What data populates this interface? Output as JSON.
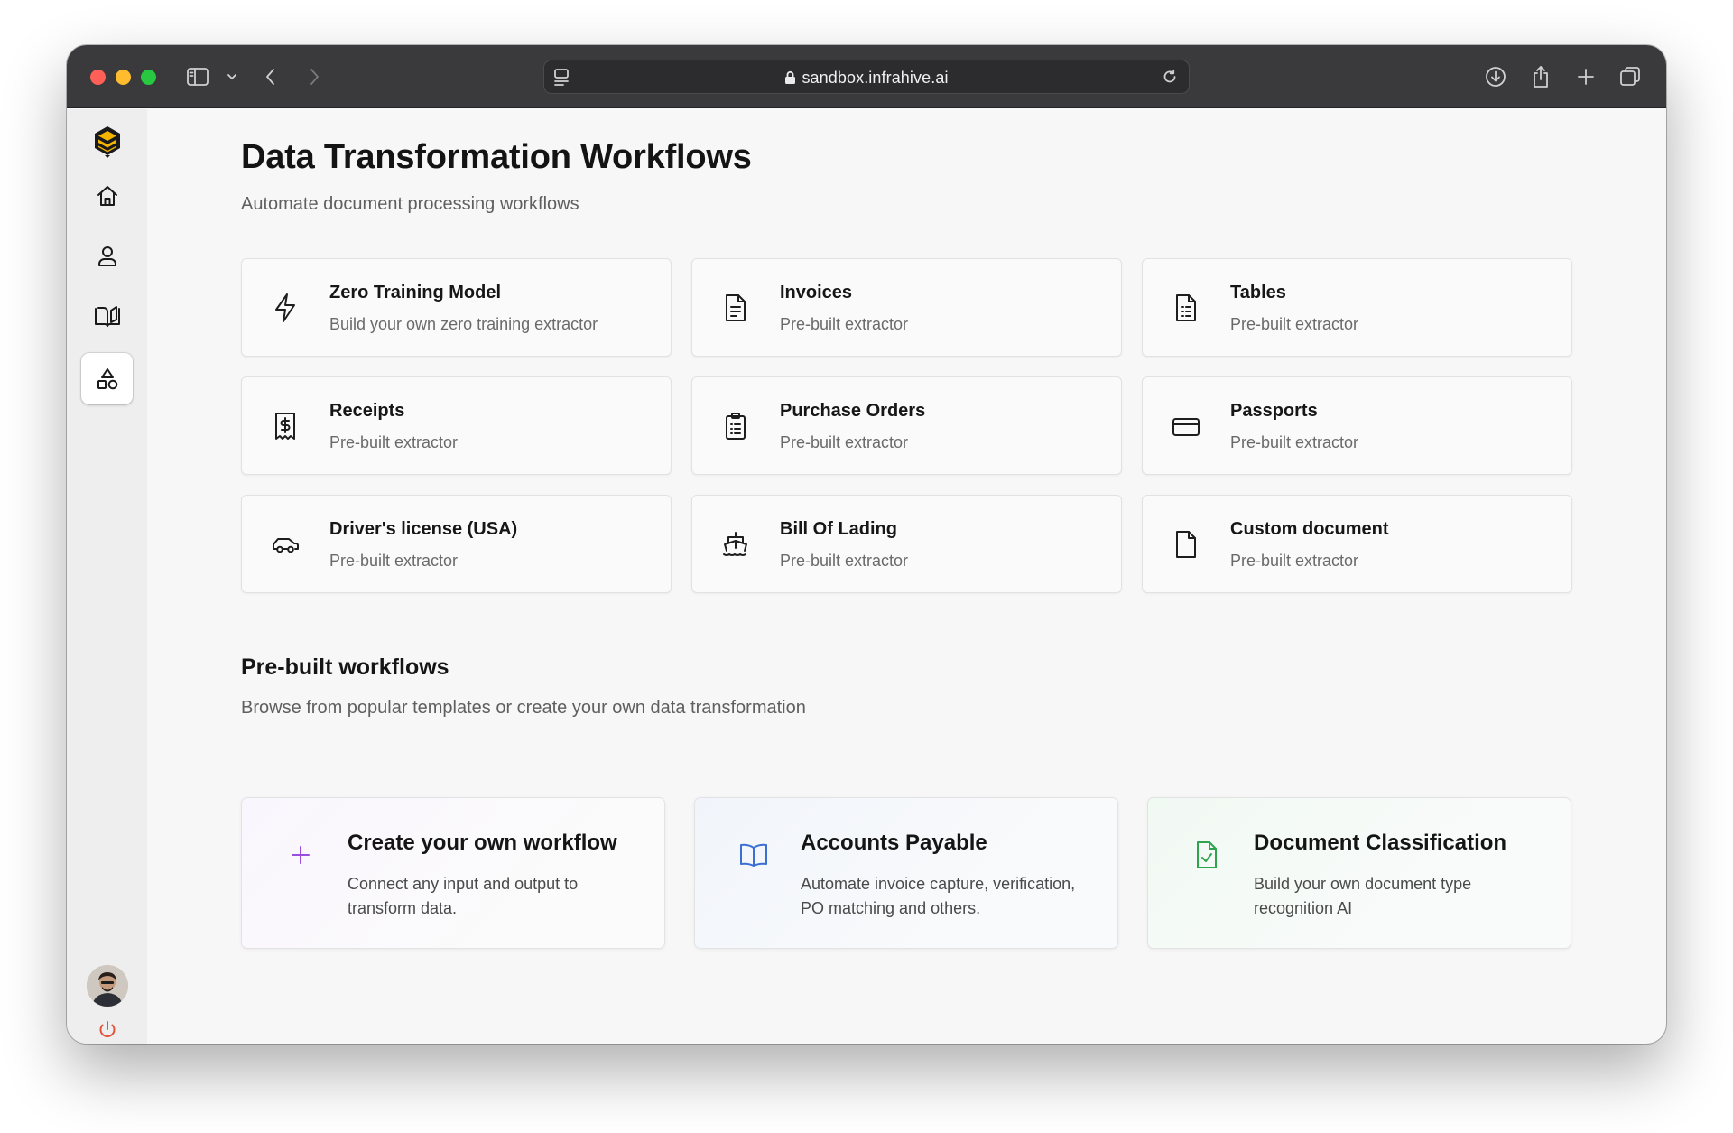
{
  "browser": {
    "url": "sandbox.infrahive.ai"
  },
  "page": {
    "title": "Data Transformation Workflows",
    "subtitle": "Automate document processing workflows"
  },
  "extractors": [
    {
      "title": "Zero Training Model",
      "subtitle": "Build your own zero training extractor",
      "icon": "lightning-icon"
    },
    {
      "title": "Invoices",
      "subtitle": "Pre-built extractor",
      "icon": "document-text-icon"
    },
    {
      "title": "Tables",
      "subtitle": "Pre-built extractor",
      "icon": "table-document-icon"
    },
    {
      "title": "Receipts",
      "subtitle": "Pre-built extractor",
      "icon": "receipt-dollar-icon"
    },
    {
      "title": "Purchase Orders",
      "subtitle": "Pre-built extractor",
      "icon": "clipboard-list-icon"
    },
    {
      "title": "Passports",
      "subtitle": "Pre-built extractor",
      "icon": "credit-card-icon"
    },
    {
      "title": "Driver's license (USA)",
      "subtitle": "Pre-built extractor",
      "icon": "car-icon"
    },
    {
      "title": "Bill Of Lading",
      "subtitle": "Pre-built extractor",
      "icon": "ship-icon"
    },
    {
      "title": "Custom document",
      "subtitle": "Pre-built extractor",
      "icon": "blank-document-icon"
    }
  ],
  "prebuilt": {
    "title": "Pre-built workflows",
    "subtitle": "Browse from popular templates or create your own data transformation",
    "workflows": [
      {
        "title": "Create your own workflow",
        "description": "Connect any input and output to transform data.",
        "icon": "plus-icon",
        "color": "#9b4de0"
      },
      {
        "title": "Accounts Payable",
        "description": "Automate invoice capture, verification, PO matching and others.",
        "icon": "open-book-icon",
        "color": "#3b6fd4"
      },
      {
        "title": "Document Classification",
        "description": "Build your own document type recognition AI",
        "icon": "document-check-icon",
        "color": "#2ea44f"
      }
    ]
  },
  "colors": {
    "logo": "#f5b400",
    "power": "#e5533d"
  }
}
